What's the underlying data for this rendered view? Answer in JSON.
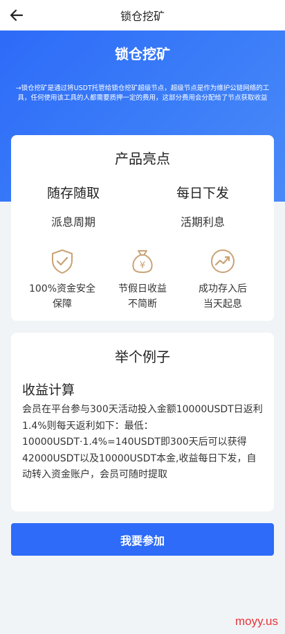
{
  "topbar": {
    "title": "锁仓挖矿"
  },
  "hero": {
    "title": "锁仓挖矿",
    "description": "→锁仓挖矿是通过将USDT托管给锁仓挖矿超级节点，超级节点是作为维护公链网络的工具，任何使用该工具的人都需要质押一定的费用，这部分费用会分配给了节点获取收益"
  },
  "highlights": {
    "title": "产品亮点",
    "items": [
      {
        "big": "随存随取",
        "sub": "派息周期"
      },
      {
        "big": "每日下发",
        "sub": "活期利息"
      }
    ],
    "features": [
      {
        "icon": "shield-check-icon",
        "line1": "100%资金安全",
        "line2": "保障"
      },
      {
        "icon": "money-bag-icon",
        "line1": "节假日收益",
        "line2": "不简断"
      },
      {
        "icon": "trend-up-icon",
        "line1": "成功存入后",
        "line2": "当天起息"
      }
    ]
  },
  "example": {
    "title": "举个例子",
    "subtitle": "收益计算",
    "body": "会员在平台参与300天活动投入金额10000USDT日返利1.4%则每天返利如下：最低：10000USDT·1.4%=140USDT即300天后可以获得42000USDT以及10000USDT本金,收益每日下发，自动转入资金账户，会员可随时提取"
  },
  "join_label": "我要参加",
  "watermark": "moyy.us",
  "colors": {
    "accent": "#2d6bf8",
    "icon_gold": "#c9a274"
  }
}
